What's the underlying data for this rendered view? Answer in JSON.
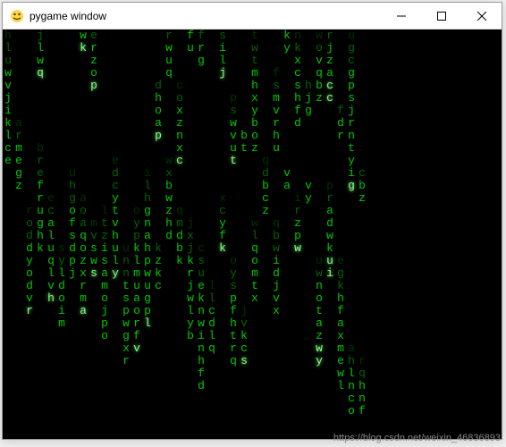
{
  "window": {
    "title": "pygame window",
    "icon_name": "pygame-snake-icon"
  },
  "controls": {
    "minimize": "Minimize",
    "maximize": "Maximize",
    "close": "Close"
  },
  "watermark": "https://blog.csdn.net/weixin_46836893",
  "matrix": {
    "char_width": 12,
    "char_height": 14,
    "colors": {
      "bright": "#80ff80",
      "normal": "#00c800",
      "dim": "#006400",
      "faint": "#003200"
    },
    "columns": [
      {
        "x": 0,
        "start": 0,
        "chars": "hluwvjiklce",
        "tail": 3,
        "lead": 0
      },
      {
        "x": 1,
        "start": 7,
        "chars": "armegz",
        "tail": 2,
        "lead": 0
      },
      {
        "x": 2,
        "start": 14,
        "chars": "roddyodvr",
        "tail": 3,
        "lead": 1
      },
      {
        "x": 3,
        "start": 0,
        "chars": "jlwq",
        "tail": 1,
        "lead": 1
      },
      {
        "x": 3,
        "start": 9,
        "chars": "brefrughk",
        "tail": 3,
        "lead": 0
      },
      {
        "x": 4,
        "start": 13,
        "chars": "ecaluqlvh",
        "tail": 2,
        "lead": 1
      },
      {
        "x": 5,
        "start": 17,
        "chars": "syldoim",
        "tail": 2,
        "lead": 0
      },
      {
        "x": 6,
        "start": 11,
        "chars": "uhgofsdpj",
        "tail": 3,
        "lead": 0
      },
      {
        "x": 7,
        "start": 0,
        "chars": "wk",
        "tail": 0,
        "lead": 1
      },
      {
        "x": 7,
        "start": 13,
        "chars": "aoaqozxrma",
        "tail": 3,
        "lead": 1
      },
      {
        "x": 8,
        "start": 0,
        "chars": "erzop",
        "tail": 1,
        "lead": 1
      },
      {
        "x": 8,
        "start": 15,
        "chars": "mvsws",
        "tail": 2,
        "lead": 1
      },
      {
        "x": 9,
        "start": 14,
        "chars": "ltzisamojpo",
        "tail": 3,
        "lead": 0
      },
      {
        "x": 10,
        "start": 10,
        "chars": "edcytvhuly",
        "tail": 3,
        "lead": 1
      },
      {
        "x": 11,
        "start": 17,
        "chars": "unntspwgxr",
        "tail": 3,
        "lead": 0
      },
      {
        "x": 12,
        "start": 14,
        "chars": "oypklmuaorfv",
        "tail": 3,
        "lead": 1
      },
      {
        "x": 13,
        "start": 11,
        "chars": "ilhgnahpwugpl",
        "tail": 3,
        "lead": 1
      },
      {
        "x": 14,
        "start": 4,
        "chars": "dhoap",
        "tail": 1,
        "lead": 1
      },
      {
        "x": 14,
        "start": 17,
        "chars": "kzkc",
        "tail": 1,
        "lead": 0
      },
      {
        "x": 15,
        "start": 0,
        "chars": "rwuq",
        "tail": 1,
        "lead": 0
      },
      {
        "x": 15,
        "start": 10,
        "chars": "wxbwzhd",
        "tail": 2,
        "lead": 0
      },
      {
        "x": 16,
        "start": 4,
        "chars": "coxznxc",
        "tail": 2,
        "lead": 1
      },
      {
        "x": 16,
        "start": 14,
        "chars": "qmdbk",
        "tail": 2,
        "lead": 0
      },
      {
        "x": 17,
        "start": 0,
        "chars": "fu",
        "tail": 0,
        "lead": 0
      },
      {
        "x": 17,
        "start": 15,
        "chars": "jxjkrjwlyb",
        "tail": 3,
        "lead": 0
      },
      {
        "x": 18,
        "start": 0,
        "chars": "frg",
        "tail": 1,
        "lead": 0
      },
      {
        "x": 18,
        "start": 17,
        "chars": "csueknwinhfd",
        "tail": 3,
        "lead": 0
      },
      {
        "x": 19,
        "start": 20,
        "chars": "llcdlq",
        "tail": 2,
        "lead": 0
      },
      {
        "x": 20,
        "start": 0,
        "chars": "silj",
        "tail": 1,
        "lead": 1
      },
      {
        "x": 20,
        "start": 13,
        "chars": "xcyfk",
        "tail": 2,
        "lead": 1
      },
      {
        "x": 21,
        "start": 5,
        "chars": "pswvut",
        "tail": 2,
        "lead": 1
      },
      {
        "x": 21,
        "start": 18,
        "chars": "oyspfhtrq",
        "tail": 3,
        "lead": 0
      },
      {
        "x": 22,
        "start": 8,
        "chars": "bt",
        "tail": 0,
        "lead": 0
      },
      {
        "x": 22,
        "start": 22,
        "chars": "jvkcs",
        "tail": 2,
        "lead": 1
      },
      {
        "x": 23,
        "start": 0,
        "chars": "twtmhxyboz",
        "tail": 3,
        "lead": 0
      },
      {
        "x": 23,
        "start": 15,
        "chars": "wlqomtx",
        "tail": 2,
        "lead": 0
      },
      {
        "x": 24,
        "start": 10,
        "chars": "qdbcz",
        "tail": 2,
        "lead": 0
      },
      {
        "x": 25,
        "start": 3,
        "chars": "fsmvrhu",
        "tail": 2,
        "lead": 0
      },
      {
        "x": 25,
        "start": 15,
        "chars": "qbwidjvx",
        "tail": 3,
        "lead": 0
      },
      {
        "x": 26,
        "start": 0,
        "chars": "ky",
        "tail": 0,
        "lead": 0
      },
      {
        "x": 26,
        "start": 11,
        "chars": "va",
        "tail": 0,
        "lead": 0
      },
      {
        "x": 27,
        "start": 0,
        "chars": "nkxcshfd",
        "tail": 2,
        "lead": 0
      },
      {
        "x": 27,
        "start": 13,
        "chars": "irzpw",
        "tail": 2,
        "lead": 1
      },
      {
        "x": 28,
        "start": 4,
        "chars": "hjg",
        "tail": 1,
        "lead": 0
      },
      {
        "x": 28,
        "start": 12,
        "chars": "vy",
        "tail": 0,
        "lead": 0
      },
      {
        "x": 29,
        "start": 0,
        "chars": "wovqbz",
        "tail": 2,
        "lead": 0
      },
      {
        "x": 29,
        "start": 18,
        "chars": "uwnotazwy",
        "tail": 2,
        "lead": 2
      },
      {
        "x": 30,
        "start": 0,
        "chars": "rjzacc",
        "tail": 1,
        "lead": 2
      },
      {
        "x": 30,
        "start": 12,
        "chars": "pradwkui",
        "tail": 2,
        "lead": 2
      },
      {
        "x": 31,
        "start": 6,
        "chars": "fdr",
        "tail": 1,
        "lead": 0
      },
      {
        "x": 31,
        "start": 18,
        "chars": "egkhfaxmewl",
        "tail": 3,
        "lead": 0
      },
      {
        "x": 32,
        "start": 0,
        "chars": "ugcgpsjrntyig",
        "tail": 3,
        "lead": 1
      },
      {
        "x": 32,
        "start": 25,
        "chars": "ahlnco",
        "tail": 2,
        "lead": 0
      },
      {
        "x": 33,
        "start": 11,
        "chars": "cbz",
        "tail": 1,
        "lead": 0
      },
      {
        "x": 33,
        "start": 26,
        "chars": "rqhnf",
        "tail": 2,
        "lead": 0
      }
    ]
  }
}
